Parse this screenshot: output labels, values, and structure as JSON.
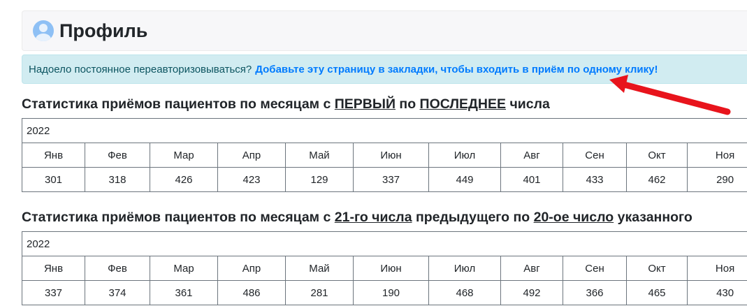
{
  "header": {
    "title": "Профиль",
    "icon": "user-avatar-icon"
  },
  "alert": {
    "text": "Надоело постоянное переавторизовываться?",
    "link": "Добавьте эту страницу в закладки, чтобы входить в приём по одному клику!"
  },
  "section1": {
    "prefix": "Статистика приёмов пациентов по месяцам с",
    "from": "ПЕРВЫЙ",
    "mid": "по",
    "to": "ПОСЛЕДНЕЕ",
    "suffix": "числа",
    "year": "2022",
    "months": [
      "Янв",
      "Фев",
      "Мар",
      "Апр",
      "Май",
      "Июн",
      "Июл",
      "Авг",
      "Сен",
      "Окт",
      "Ноя"
    ],
    "values": [
      "301",
      "318",
      "426",
      "423",
      "129",
      "337",
      "449",
      "401",
      "433",
      "462",
      "290"
    ]
  },
  "section2": {
    "prefix": "Статистика приёмов пациентов по месяцам с",
    "from": "21-го числа",
    "mid": "предыдущего по",
    "to": "20-ое число",
    "suffix": "указанного",
    "year": "2022",
    "months": [
      "Янв",
      "Фев",
      "Мар",
      "Апр",
      "Май",
      "Июн",
      "Июл",
      "Авг",
      "Сен",
      "Окт",
      "Ноя"
    ],
    "values": [
      "337",
      "374",
      "361",
      "486",
      "281",
      "190",
      "468",
      "492",
      "366",
      "465",
      "430"
    ]
  },
  "annotation": {
    "arrow_color": "#e8141c"
  }
}
